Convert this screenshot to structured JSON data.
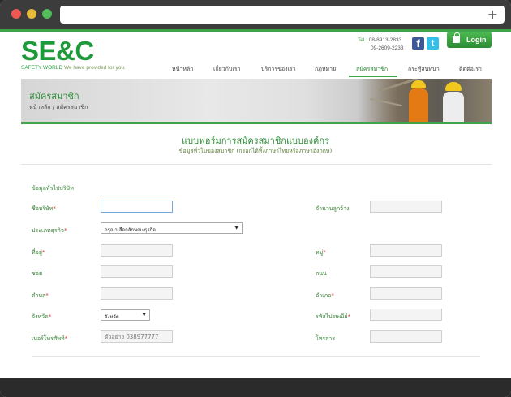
{
  "browser": {
    "new_tab": "+"
  },
  "header": {
    "logo": "SE&C",
    "tagline_brand": "SAFETY WORLD",
    "tagline_text": "We have provided for you.",
    "tel_label": "Tel :",
    "phone1": "08-8913-2833",
    "phone2": "09-2609-2233",
    "facebook_glyph": "f",
    "twitter_glyph": "t",
    "login_label": "Login"
  },
  "nav": {
    "items": [
      {
        "label": "หน้าหลัก"
      },
      {
        "label": "เกี่ยวกับเรา"
      },
      {
        "label": "บริการของเรา"
      },
      {
        "label": "กฎหมาย"
      },
      {
        "label": "สมัครสมาชิก"
      },
      {
        "label": "กระทู้สนทนา"
      },
      {
        "label": "ติดต่อเรา"
      }
    ],
    "active_index": 4
  },
  "banner": {
    "title": "สมัครสมาชิก",
    "breadcrumb": "หน้าหลัก / สมัครสมาชิก"
  },
  "form": {
    "title": "แบบฟอร์มการสมัครสมาชิกแบบองค์กร",
    "subtitle": "ข้อมูลทั่วไปของสมาชิก (กรอกได้ทั้งภาษาไทยหรือภาษาอังกฤษ)",
    "section": "ข้อมูลทั่วไปบริษัท",
    "fields": {
      "company_name": {
        "label": "ชื่อบริษัท",
        "required": "*",
        "value": ""
      },
      "employee_count": {
        "label": "จำนวนลูกจ้าง",
        "value": ""
      },
      "business_type": {
        "label": "ประเภทธุรกิจ",
        "required": "*",
        "selected": "กรุณาเลือกลักษณะธุรกิจ"
      },
      "address": {
        "label": "ที่อยู่",
        "required": "*",
        "value": ""
      },
      "moo": {
        "label": "หมู่",
        "required": "*",
        "value": ""
      },
      "soi": {
        "label": "ซอย",
        "value": ""
      },
      "road": {
        "label": "ถนน",
        "value": ""
      },
      "subdistrict": {
        "label": "ตำบล",
        "required": "*",
        "value": ""
      },
      "district": {
        "label": "อำเภอ",
        "required": "*",
        "value": ""
      },
      "province": {
        "label": "จังหวัด",
        "required": "*",
        "selected": "จังหวัด"
      },
      "postcode": {
        "label": "รหัสไปรษณีย์",
        "required": "*",
        "value": ""
      },
      "phone": {
        "label": "เบอร์โทรศัพท์",
        "required": "*",
        "placeholder": "ตัวอย่าง 038977777"
      },
      "fax": {
        "label": "โทรสาร",
        "value": ""
      }
    }
  },
  "colors": {
    "brand_green": "#1e9a3b",
    "accent_green": "#3fa34a",
    "required_red": "#d33"
  }
}
